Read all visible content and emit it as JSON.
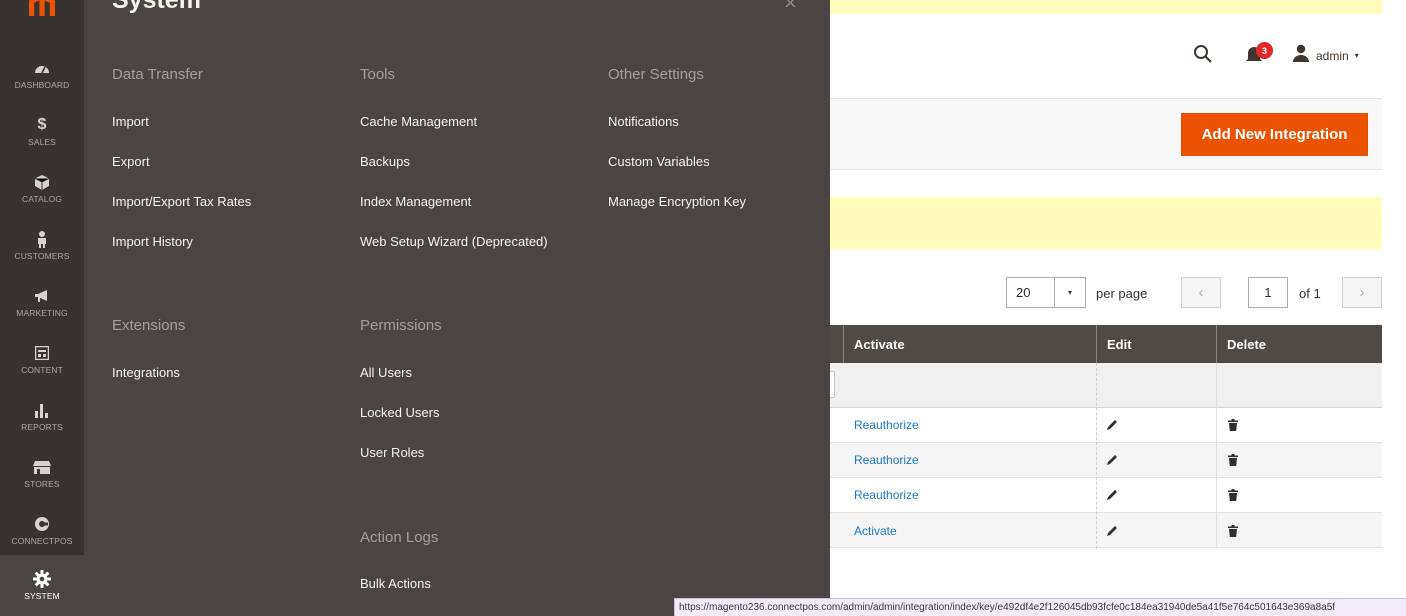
{
  "nav": {
    "items": [
      {
        "label": "DASHBOARD",
        "icon": "dashboard-icon"
      },
      {
        "label": "SALES",
        "icon": "dollar-icon",
        "glyph": "$"
      },
      {
        "label": "CATALOG",
        "icon": "cube-icon"
      },
      {
        "label": "CUSTOMERS",
        "icon": "person-icon"
      },
      {
        "label": "MARKETING",
        "icon": "megaphone-icon"
      },
      {
        "label": "CONTENT",
        "icon": "layout-icon"
      },
      {
        "label": "REPORTS",
        "icon": "bar-chart-icon"
      },
      {
        "label": "STORES",
        "icon": "store-icon"
      },
      {
        "label": "CONNECTPOS",
        "icon": "connectpos-icon"
      },
      {
        "label": "SYSTEM",
        "icon": "gear-icon"
      }
    ],
    "active": "SYSTEM"
  },
  "flyout": {
    "title": "System",
    "close_glyph": "×",
    "groups": {
      "data_transfer": {
        "title": "Data Transfer",
        "links": [
          "Import",
          "Export",
          "Import/Export Tax Rates",
          "Import History"
        ]
      },
      "tools": {
        "title": "Tools",
        "links": [
          "Cache Management",
          "Backups",
          "Index Management",
          "Web Setup Wizard (Deprecated)"
        ]
      },
      "other_settings": {
        "title": "Other Settings",
        "links": [
          "Notifications",
          "Custom Variables",
          "Manage Encryption Key"
        ]
      },
      "extensions": {
        "title": "Extensions",
        "links": [
          "Integrations"
        ]
      },
      "permissions": {
        "title": "Permissions",
        "links": [
          "All Users",
          "Locked Users",
          "User Roles"
        ]
      },
      "action_logs": {
        "title": "Action Logs",
        "links": [
          "Bulk Actions"
        ]
      }
    }
  },
  "header": {
    "notification_count": "3",
    "user_name": "admin",
    "caret": "▾"
  },
  "actions": {
    "add_new_integration": "Add New Integration"
  },
  "pager": {
    "per_page_value": "20",
    "per_page_caret": "▾",
    "per_page_label": "per page",
    "prev": "‹",
    "current_page": "1",
    "total_label": "of 1",
    "next": "›"
  },
  "table": {
    "columns": [
      "Activate",
      "Edit",
      "Delete"
    ],
    "rows": [
      {
        "activate": "Reauthorize"
      },
      {
        "activate": "Reauthorize"
      },
      {
        "activate": "Reauthorize"
      },
      {
        "activate": "Activate"
      }
    ]
  },
  "statusbar": {
    "url": "https://magento236.connectpos.com/admin/admin/integration/index/key/e492df4e2f126045db93fcfe0c184ea31940de5a41f5e764c501643e369a8a5f"
  },
  "colors": {
    "accent": "#eb5202",
    "nav_bg": "#373330",
    "flyout_bg": "#4a4542",
    "header_bg": "#514943",
    "link": "#1979c3",
    "notice": "#fffbbb"
  }
}
